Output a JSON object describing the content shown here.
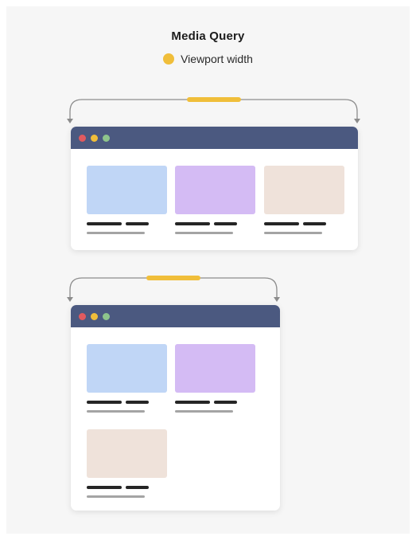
{
  "title": "Media Query",
  "legend": {
    "label": "Viewport width",
    "color": "#f0be3a"
  },
  "colors": {
    "titlebar": "#4b5980",
    "traffic_red": "#e15a5f",
    "traffic_yellow": "#f0be3a",
    "traffic_green": "#8ec58c",
    "arrow": "#8c8c8c",
    "viewport_marker": "#f0be3a",
    "card_blue": "#c0d6f6",
    "card_purple": "#d4bbf4",
    "card_beige": "#efe2da",
    "line_dark": "#252525",
    "line_grey": "#a4a4a4"
  },
  "icons": {
    "window_controls": [
      "close-dot",
      "minimize-dot",
      "maximize-dot"
    ],
    "arrows": [
      "arrow-down-left",
      "arrow-down-right"
    ]
  },
  "diagram": {
    "wide_viewport": {
      "columns": 3,
      "cards": [
        {
          "name": "card-blue",
          "color": "#c0d6f6"
        },
        {
          "name": "card-purple",
          "color": "#d4bbf4"
        },
        {
          "name": "card-beige",
          "color": "#efe2da"
        }
      ]
    },
    "narrow_viewport": {
      "columns": 2,
      "cards": [
        {
          "name": "card-blue",
          "color": "#c0d6f6"
        },
        {
          "name": "card-purple",
          "color": "#d4bbf4"
        },
        {
          "name": "card-beige",
          "color": "#efe2da"
        }
      ]
    }
  }
}
